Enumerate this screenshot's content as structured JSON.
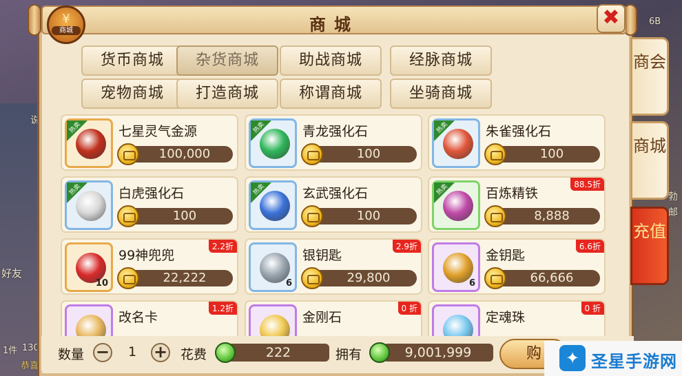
{
  "title": "商城",
  "badge_label": "商城",
  "badge_symbol": "¥",
  "close_symbol": "✖",
  "categories": [
    {
      "label": "货币商城",
      "active": false
    },
    {
      "label": "杂货商城",
      "active": true
    },
    {
      "label": "助战商城",
      "active": false
    },
    {
      "label": "经脉商城",
      "active": false
    },
    {
      "label": "宠物商城",
      "active": false
    },
    {
      "label": "打造商城",
      "active": false
    },
    {
      "label": "称谓商城",
      "active": false
    },
    {
      "label": "坐骑商城",
      "active": false
    }
  ],
  "side_tabs": [
    "商会",
    "商城",
    "充值"
  ],
  "hot_label": "热卖",
  "items": [
    {
      "name": "七星灵气金源",
      "price": "100,000",
      "hot": true,
      "discount": "",
      "qty": "",
      "frame": "gold",
      "gem": "#c0301c"
    },
    {
      "name": "青龙强化石",
      "price": "100",
      "hot": true,
      "discount": "",
      "qty": "",
      "frame": "blue",
      "gem": "#2fb65a"
    },
    {
      "name": "朱雀强化石",
      "price": "100",
      "hot": true,
      "discount": "",
      "qty": "",
      "frame": "blue",
      "gem": "#e0563a"
    },
    {
      "name": "白虎强化石",
      "price": "100",
      "hot": true,
      "discount": "",
      "qty": "",
      "frame": "blue",
      "gem": "#d8d8d8"
    },
    {
      "name": "玄武强化石",
      "price": "100",
      "hot": true,
      "discount": "",
      "qty": "",
      "frame": "blue",
      "gem": "#3a72d8"
    },
    {
      "name": "百炼精铁",
      "price": "8,888",
      "hot": true,
      "discount": "88.5折",
      "qty": "",
      "frame": "green",
      "gem": "#c04aa8"
    },
    {
      "name": "99神兜兜",
      "price": "22,222",
      "hot": false,
      "discount": "2.2折",
      "qty": "10",
      "frame": "gold",
      "gem": "#d82a2a"
    },
    {
      "name": "银钥匙",
      "price": "29,800",
      "hot": false,
      "discount": "2.9折",
      "qty": "6",
      "frame": "blue",
      "gem": "#9aa6b0"
    },
    {
      "name": "金钥匙",
      "price": "66,666",
      "hot": false,
      "discount": "6.6折",
      "qty": "6",
      "frame": "purple",
      "gem": "#e0a02a"
    },
    {
      "name": "改名卡",
      "price": "",
      "hot": false,
      "discount": "1.2折",
      "qty": "",
      "frame": "purple",
      "gem": "#e8b860"
    },
    {
      "name": "金刚石",
      "price": "",
      "hot": false,
      "discount": "0 折",
      "qty": "",
      "frame": "purple",
      "gem": "#f0c850"
    },
    {
      "name": "定魂珠",
      "price": "",
      "hot": false,
      "discount": "0 折",
      "qty": "",
      "frame": "purple",
      "gem": "#7ac8f0"
    }
  ],
  "bottom": {
    "qty_label": "数量",
    "qty_value": "1",
    "minus": "−",
    "plus": "+",
    "cost_label": "花费",
    "cost_value": "222",
    "own_label": "拥有",
    "own_value": "9,001,999",
    "buy_label": "购"
  },
  "background_text": [
    "6B",
    "说",
    "1件",
    "130",
    "好友",
    "恭喜",
    "勃",
    "邮"
  ],
  "watermark": {
    "logo": "✦",
    "text": "圣星手游网"
  }
}
